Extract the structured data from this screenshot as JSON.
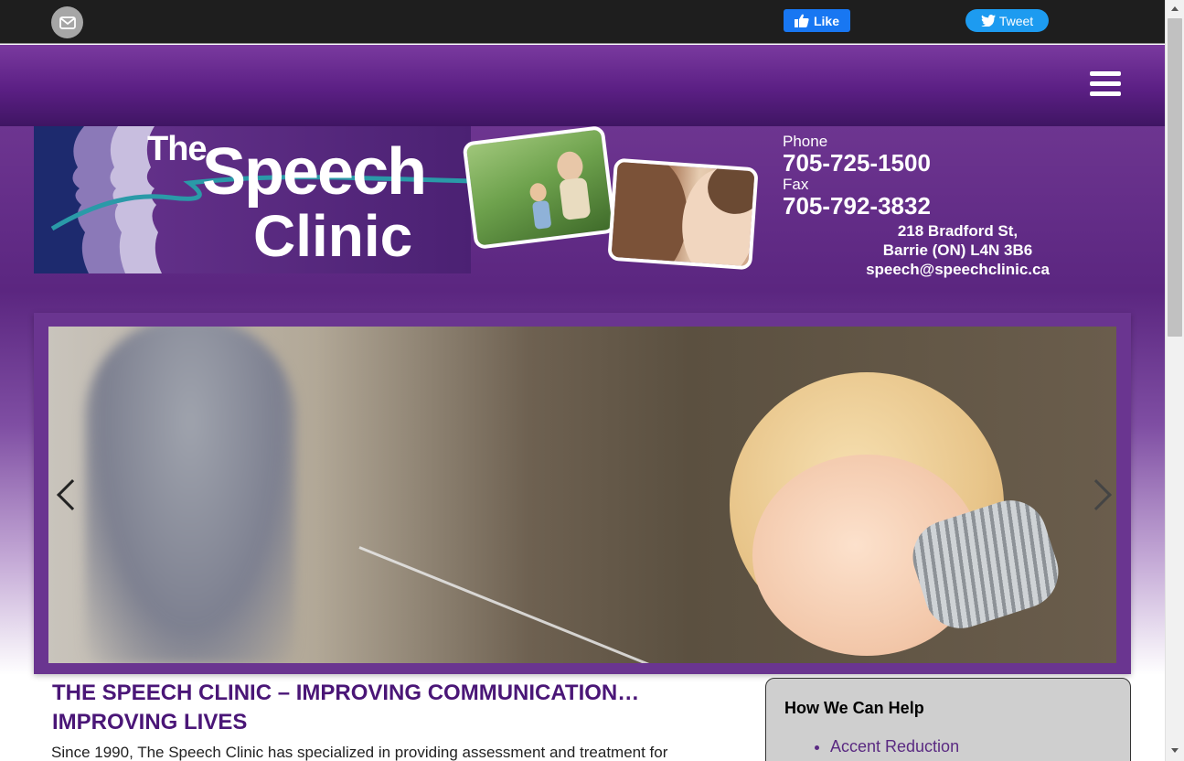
{
  "topbar": {
    "email_icon": "envelope-icon",
    "like_label": "Like",
    "like_icon": "thumbs-up-icon",
    "tweet_label": "Tweet",
    "tweet_icon": "twitter-bird-icon"
  },
  "nav": {
    "menu_icon": "hamburger-icon"
  },
  "header": {
    "logo_the": "The",
    "logo_speech": "Speech",
    "logo_clinic": "Clinic",
    "phone_label": "Phone",
    "phone": "705-725-1500",
    "fax_label": "Fax",
    "fax": "705-792-3832",
    "address_line1": "218 Bradford St,",
    "address_line2": "Barrie (ON) L4N 3B6",
    "email": "speech@speechclinic.ca"
  },
  "slider": {
    "prev_icon": "chevron-left-icon",
    "next_icon": "chevron-right-icon"
  },
  "content": {
    "title": "THE SPEECH CLINIC – IMPROVING COMMUNICATION… IMPROVING LIVES",
    "intro": "Since 1990, The Speech Clinic has specialized in providing assessment and treatment for"
  },
  "help": {
    "title": "How We Can Help",
    "items": [
      "Accent Reduction"
    ]
  },
  "colors": {
    "brand_purple": "#5b2680",
    "title_purple": "#4a1677",
    "facebook_blue": "#1877f2",
    "twitter_blue": "#1d9bf0"
  }
}
